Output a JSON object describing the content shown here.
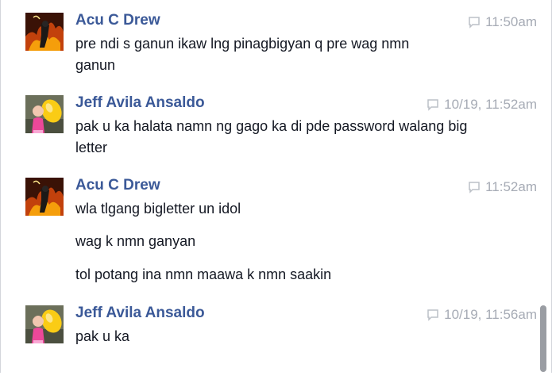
{
  "messages": [
    {
      "sender": "Acu C Drew",
      "time": "11:50am",
      "avatar": "fire-warrior-avatar",
      "lines": [
        "pre ndi s ganun ikaw lng pinagbigyan q pre wag nmn ganun"
      ]
    },
    {
      "sender": "Jeff Avila Ansaldo",
      "time": "10/19, 11:52am",
      "avatar": "girl-with-balloon-avatar",
      "lines": [
        "pak u ka halata namn ng gago ka di pde password walang big letter"
      ]
    },
    {
      "sender": "Acu C Drew",
      "time": "11:52am",
      "avatar": "fire-warrior-avatar",
      "lines": [
        "wla tlgang bigletter un idol",
        "wag k nmn ganyan",
        "tol potang ina nmn maawa k nmn saakin"
      ]
    },
    {
      "sender": "Jeff Avila Ansaldo",
      "time": "10/19, 11:56am",
      "avatar": "girl-with-balloon-avatar",
      "lines": [
        "pak u ka"
      ]
    }
  ],
  "colors": {
    "sender_name": "#3b5998",
    "timestamp": "#a6abb5",
    "message_text": "#141823"
  }
}
